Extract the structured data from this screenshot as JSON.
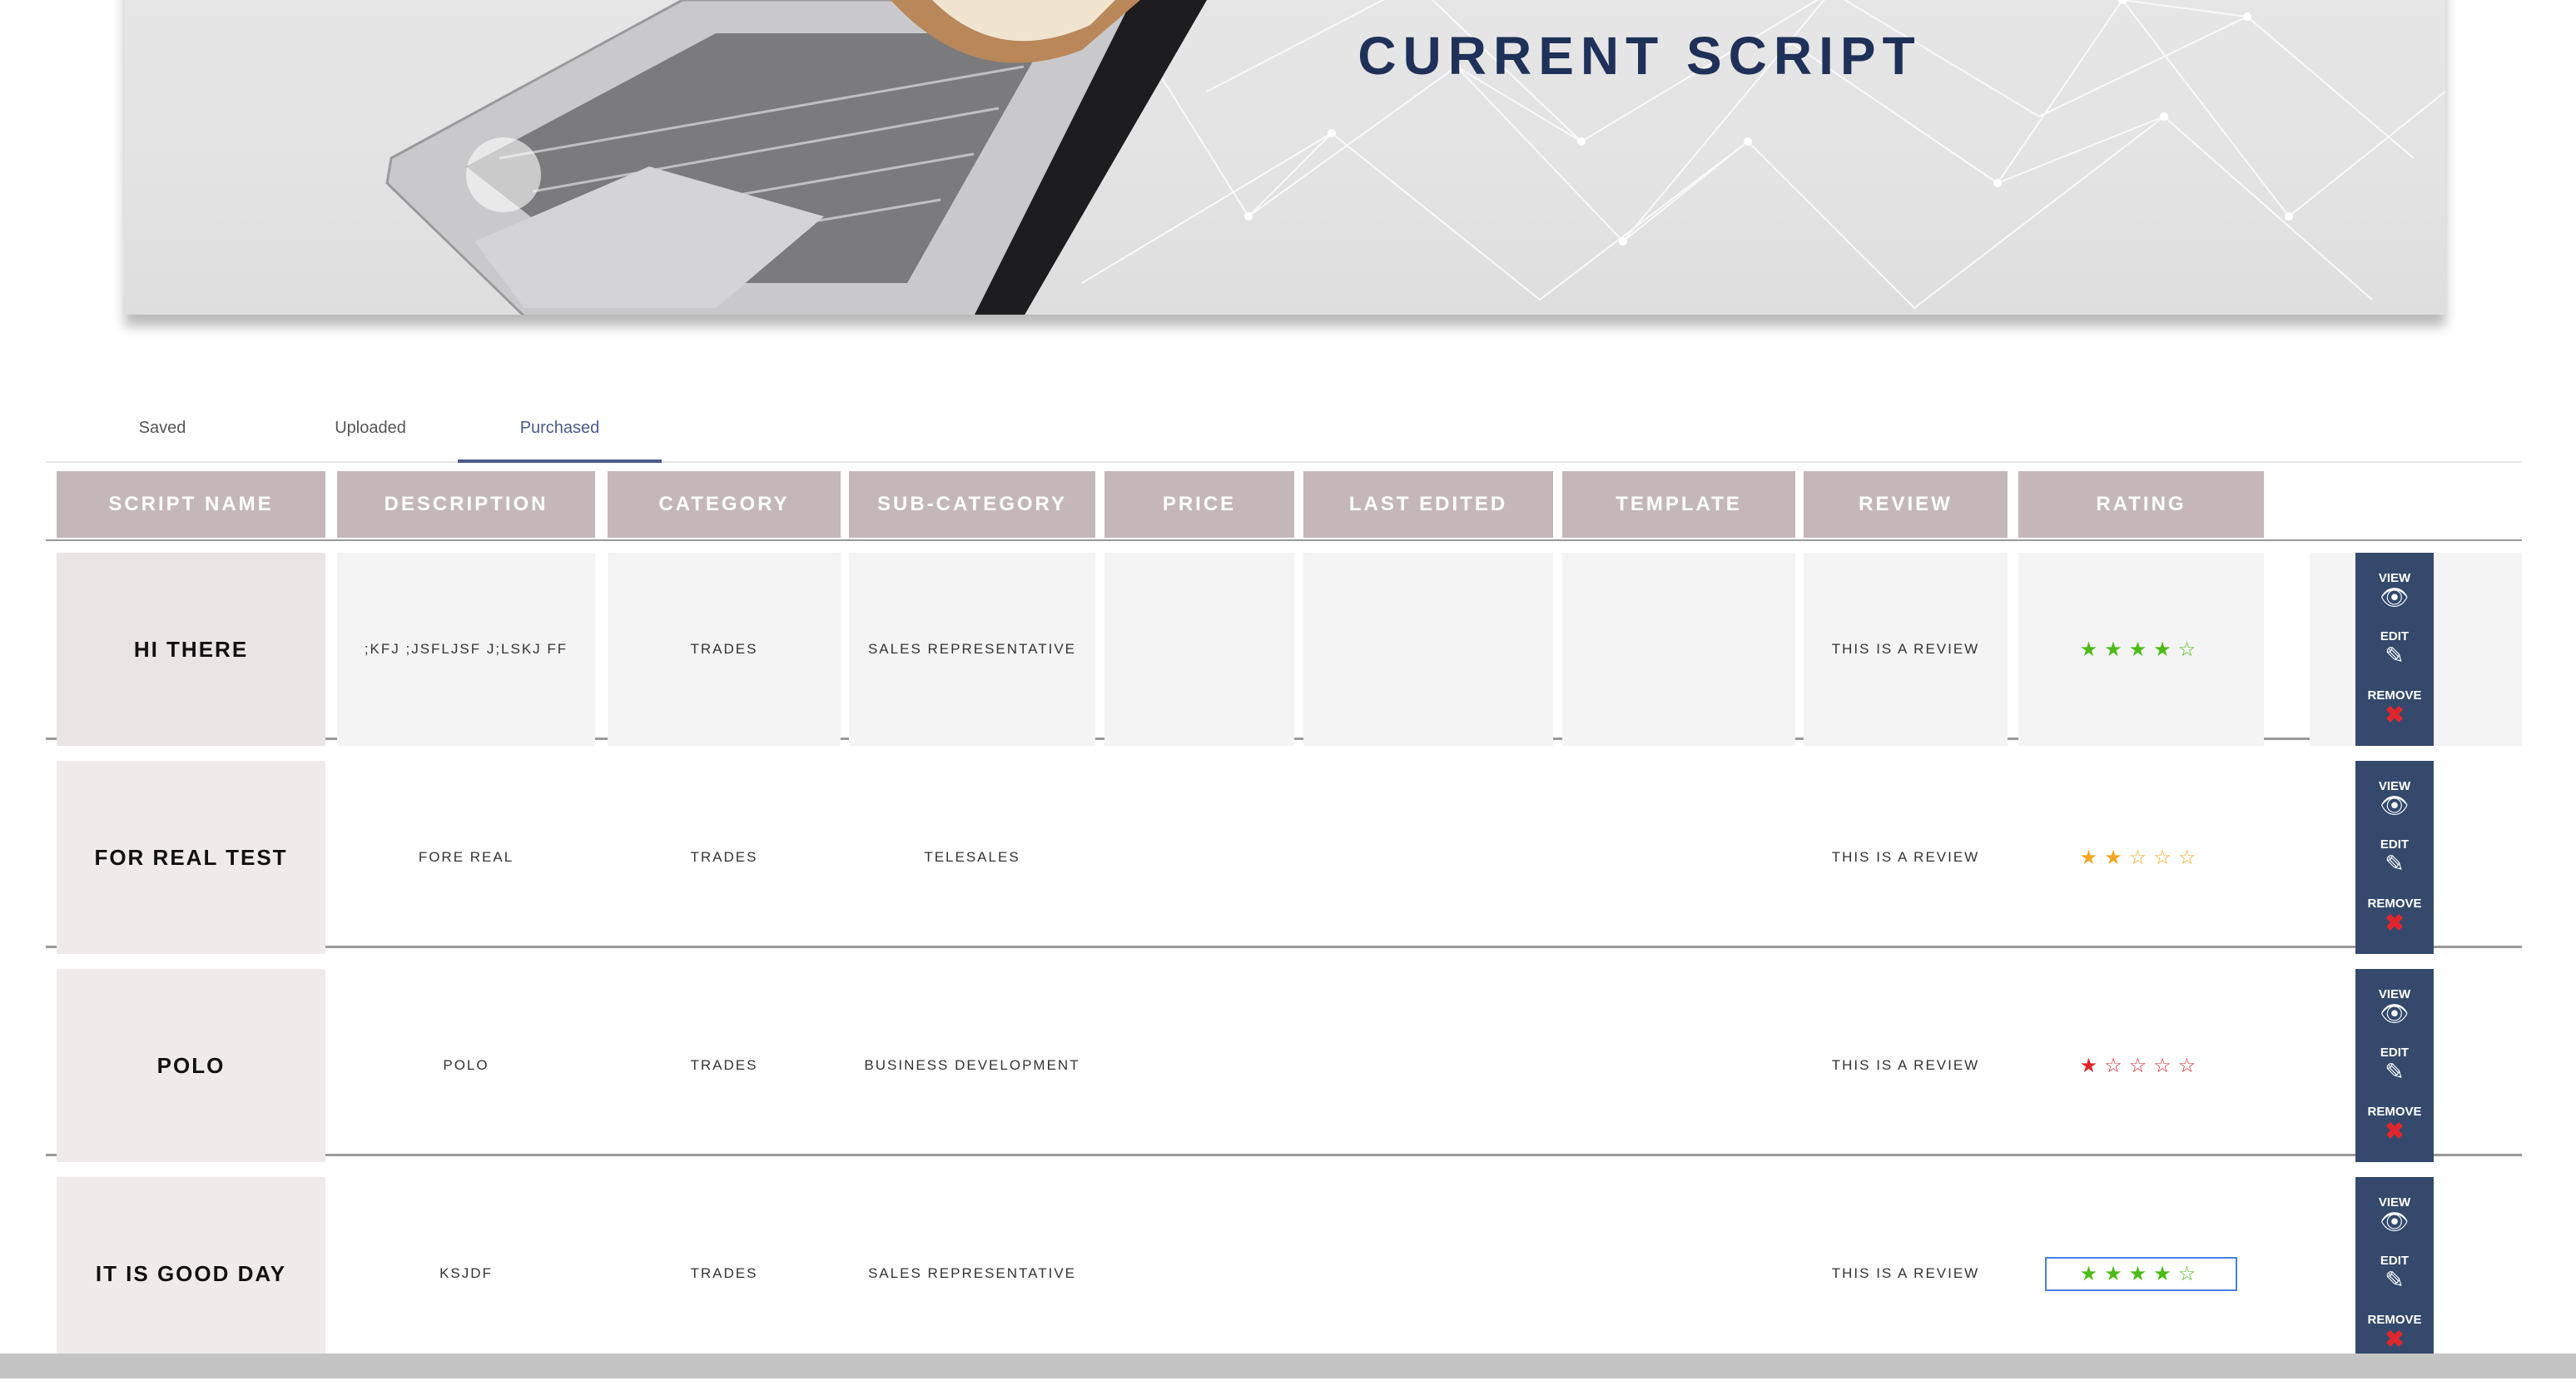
{
  "banner": {
    "title": "CURRENT SCRIPT"
  },
  "tabs": [
    {
      "label": "Saved"
    },
    {
      "label": "Uploaded"
    },
    {
      "label": "Purchased",
      "active": true
    }
  ],
  "columns": [
    "SCRIPT NAME",
    "DESCRIPTION",
    "CATEGORY",
    "SUB-CATEGORY",
    "PRICE",
    "LAST EDITED",
    "TEMPLATE",
    "REVIEW",
    "RATING"
  ],
  "actions": {
    "view": "VIEW",
    "edit": "EDIT",
    "remove": "REMOVE"
  },
  "rows": [
    {
      "name": "HI THERE",
      "description": ";KFJ ;JSFLJSF J;LSKJ FF",
      "category": "TRADES",
      "sub_category": "SALES REPRESENTATIVE",
      "price": "",
      "last_edited": "",
      "template": "",
      "review": "THIS IS A REVIEW",
      "rating": 4,
      "rating_color": "#4cbb17"
    },
    {
      "name": "FOR REAL TEST",
      "description": "FORE REAL",
      "category": "TRADES",
      "sub_category": "TELESALES",
      "price": "",
      "last_edited": "",
      "template": "",
      "review": "THIS IS A REVIEW",
      "rating": 2,
      "rating_color": "#f5a623"
    },
    {
      "name": "POLO",
      "description": "POLO",
      "category": "TRADES",
      "sub_category": "BUSINESS DEVELOPMENT",
      "price": "",
      "last_edited": "",
      "template": "",
      "review": "THIS IS A REVIEW",
      "rating": 1,
      "rating_color": "#e0262d"
    },
    {
      "name": "IT IS GOOD DAY",
      "description": "KSJDF",
      "category": "TRADES",
      "sub_category": "SALES REPRESENTATIVE",
      "price": "",
      "last_edited": "",
      "template": "",
      "review": "THIS IS A REVIEW",
      "rating": 4,
      "rating_color": "#4cbb17"
    }
  ],
  "colors": {
    "header_bg": "#c5b7b9",
    "action_bg": "#34496c",
    "title": "#1f3158",
    "tab_active": "#4a5a8a"
  }
}
